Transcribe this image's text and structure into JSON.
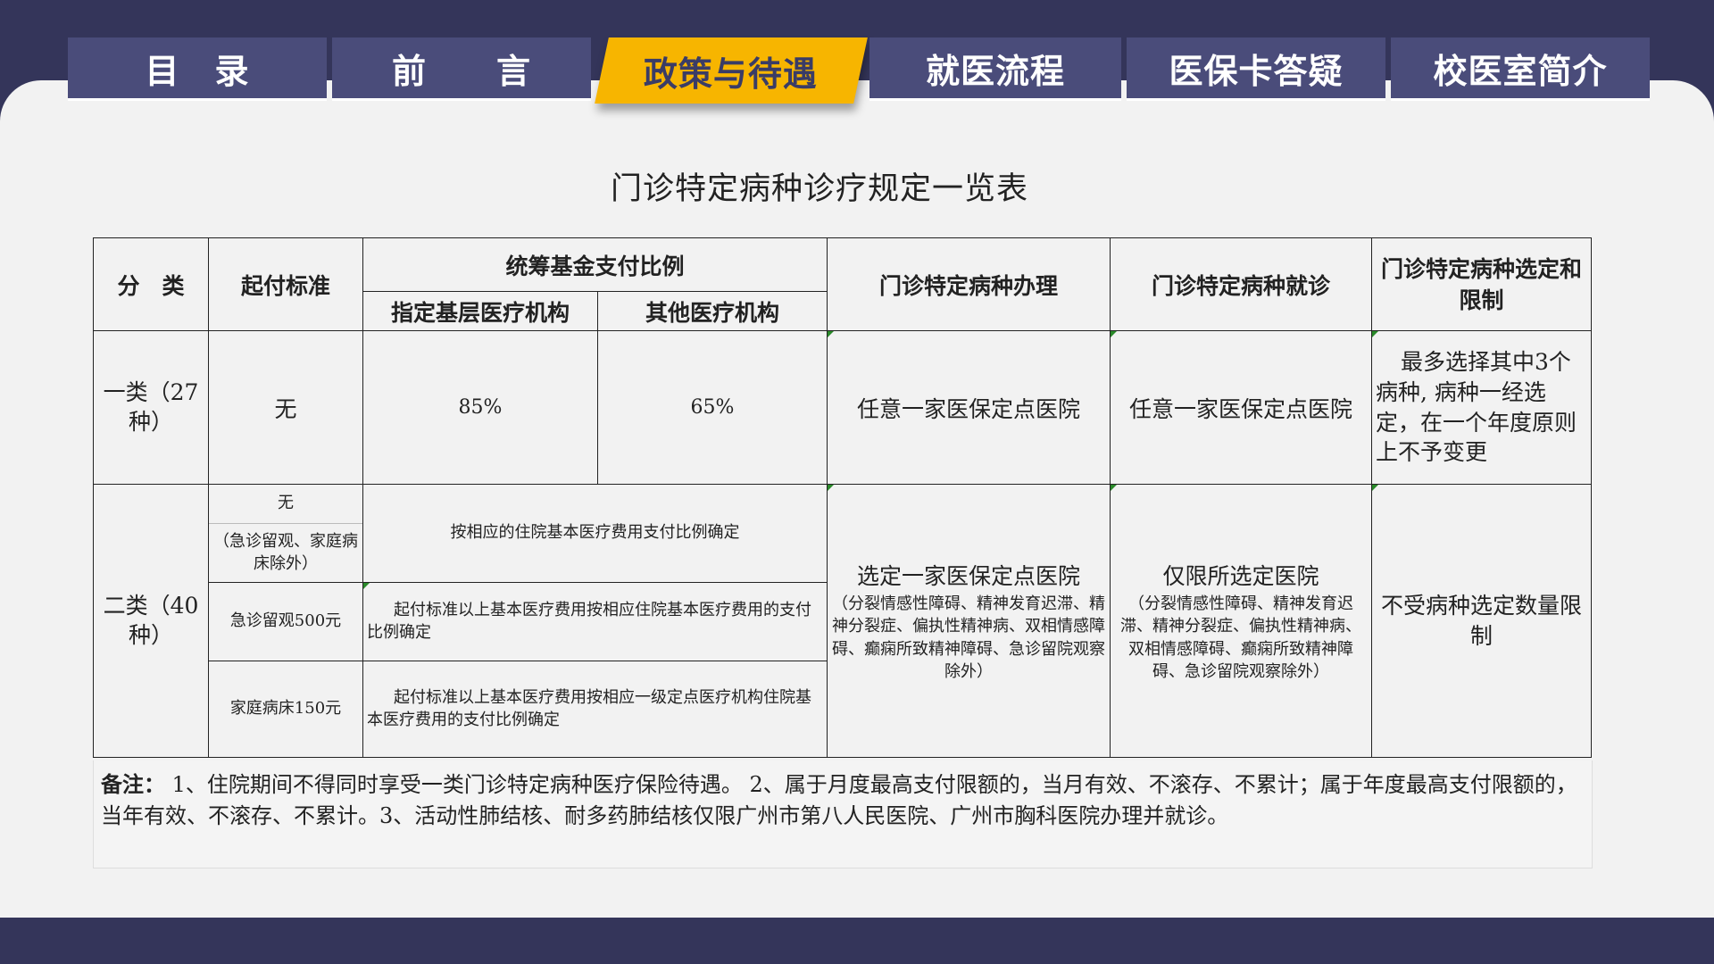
{
  "nav": {
    "tabs": [
      {
        "label": "目　录",
        "active": false
      },
      {
        "label": "前　　言",
        "active": false
      },
      {
        "label": "政策与待遇",
        "active": true
      },
      {
        "label": "就医流程",
        "active": false
      },
      {
        "label": "医保卡答疑",
        "active": false
      },
      {
        "label": "校医室简介",
        "active": false
      }
    ]
  },
  "title": "门诊特定病种诊疗规定一览表",
  "table": {
    "headers": {
      "category": "分　类",
      "threshold": "起付标准",
      "fund_ratio": "统筹基金支付比例",
      "designated": "指定基层医疗机构",
      "other": "其他医疗机构",
      "handling": "门诊特定病种办理",
      "visit": "门诊特定病种就诊",
      "selection": "门诊特定病种选定和限制"
    },
    "row1": {
      "category": "一类（27种）",
      "threshold": "无",
      "designated": "85%",
      "other": "65%",
      "handling": "任意一家医保定点医院",
      "visit": "任意一家医保定点医院",
      "selection": "最多选择其中3个病种, 病种一经选定，在一个年度原则上不予变更"
    },
    "row2": {
      "category": "二类（40种）",
      "threshold_a_main": "无",
      "threshold_a_note": "（急诊留观、家庭病床除外）",
      "ratio_a": "按相应的住院基本医疗费用支付比例确定",
      "threshold_b": "急诊留观500元",
      "ratio_b": "起付标准以上基本医疗费用按相应住院基本医疗费用的支付比例确定",
      "threshold_c": "家庭病床150元",
      "ratio_c": "起付标准以上基本医疗费用按相应一级定点医疗机构住院基本医疗费用的支付比例确定",
      "handling_main": "选定一家医保定点医院",
      "handling_note": "（分裂情感性障碍、精神发育迟滞、精神分裂症、偏执性精神病、双相情感障碍、癫痫所致精神障碍、急诊留院观察除外）",
      "visit_main": "仅限所选定医院",
      "visit_note": "（分裂情感性障碍、精神发育迟滞、精神分裂症、偏执性精神病、双相情感障碍、癫痫所致精神障碍、急诊留院观察除外）",
      "selection": "不受病种选定数量限制"
    }
  },
  "note": {
    "label": "备注：",
    "text": " 1、住院期间不得同时享受一类门诊特定病种医疗保险待遇。 2、属于月度最高支付限额的，当月有效、不滚存、不累计；属于年度最高支付限额的，当年有效、不滚存、不累计。3、活动性肺结核、耐多药肺结核仅限广州市第八人民医院、广州市胸科医院办理并就诊。"
  },
  "colors": {
    "frame": "#34355a",
    "tab": "#4a4c7a",
    "active_tab": "#f7b500",
    "panel": "#f2f2f2"
  }
}
